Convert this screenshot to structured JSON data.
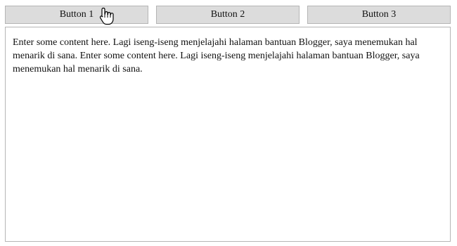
{
  "tabs": [
    {
      "label": "Button 1"
    },
    {
      "label": "Button 2"
    },
    {
      "label": "Button 3"
    }
  ],
  "content": {
    "text": "Enter some content here. Lagi iseng-iseng menjelajahi halaman bantuan Blogger, saya menemukan hal menarik di sana. Enter some content here. Lagi iseng-iseng menjelajahi halaman bantuan Blogger, saya menemukan hal menarik di sana."
  },
  "cursor": {
    "icon": "hand-pointer-icon"
  },
  "colors": {
    "button_bg": "#dcdcdc",
    "border": "#b5b5b5",
    "text": "#111111",
    "background": "#ffffff"
  }
}
